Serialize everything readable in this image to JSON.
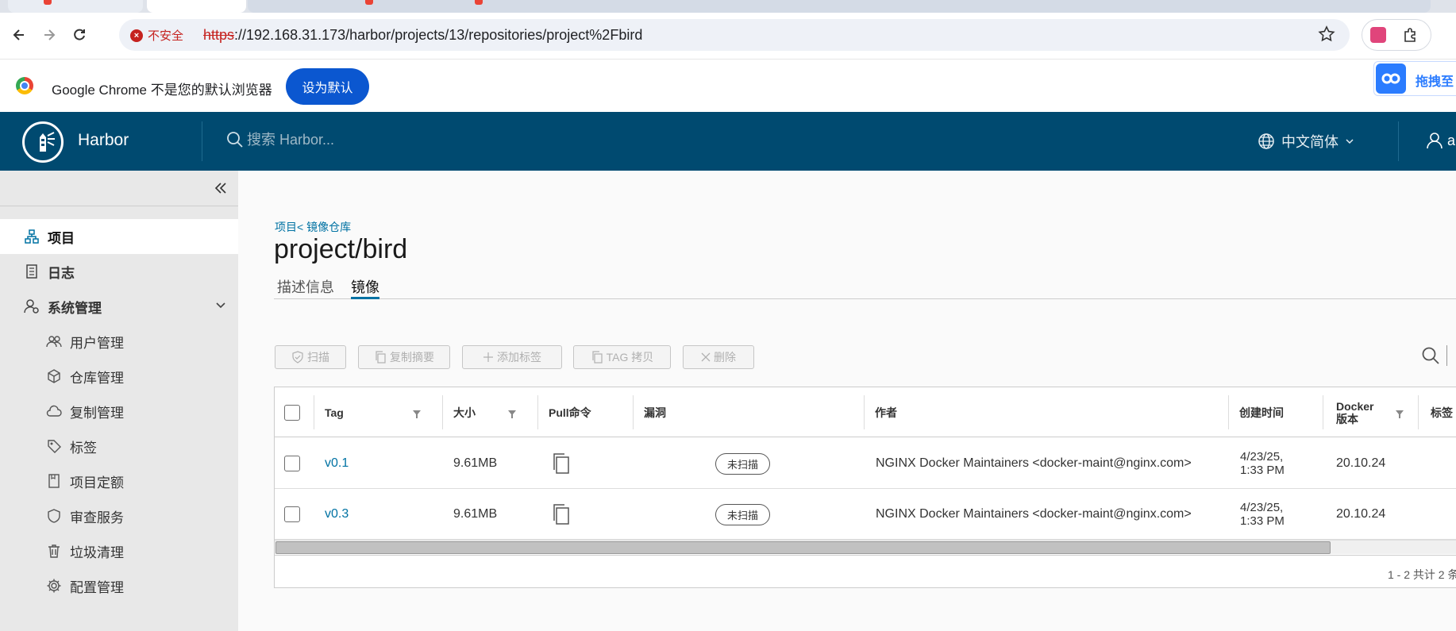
{
  "browser": {
    "security_label": "不安全",
    "url_scheme": "https",
    "url_rest": "://192.168.31.173/harbor/projects/13/repositories/project%2Fbird",
    "infobar_text": "Google Chrome 不是您的默认浏览器",
    "set_default_label": "设为默认",
    "baidu_label": "拖拽至"
  },
  "header": {
    "brand": "Harbor",
    "search_placeholder": "搜索 Harbor...",
    "language": "中文简体",
    "user_initial": "a"
  },
  "sidebar": {
    "top_items": [
      {
        "label": "项目",
        "icon": "project-icon"
      },
      {
        "label": "日志",
        "icon": "log-icon"
      },
      {
        "label": "系统管理",
        "icon": "admin-icon"
      }
    ],
    "sub_items": [
      {
        "label": "用户管理",
        "icon": "users-icon"
      },
      {
        "label": "仓库管理",
        "icon": "registry-icon"
      },
      {
        "label": "复制管理",
        "icon": "replication-icon"
      },
      {
        "label": "标签",
        "icon": "tag-icon"
      },
      {
        "label": "项目定额",
        "icon": "quota-icon"
      },
      {
        "label": "审查服务",
        "icon": "shield-icon"
      },
      {
        "label": "垃圾清理",
        "icon": "trash-icon"
      },
      {
        "label": "配置管理",
        "icon": "gear-icon"
      }
    ]
  },
  "page": {
    "breadcrumb": "项目< 镜像仓库",
    "title": "project/bird",
    "tabs": [
      "描述信息",
      "镜像"
    ],
    "active_tab": "镜像"
  },
  "actions": {
    "scan": "扫描",
    "copy_digest": "复制摘要",
    "add_label": "添加标签",
    "tag_copy": "TAG 拷贝",
    "delete": "删除"
  },
  "table": {
    "columns": {
      "tag": "Tag",
      "size": "大小",
      "pull": "Pull命令",
      "vuln": "漏洞",
      "author": "作者",
      "created": "创建时间",
      "docker_line1": "Docker",
      "docker_line2": "版本",
      "labels": "标签"
    },
    "rows": [
      {
        "tag": "v0.1",
        "size": "9.61MB",
        "vuln": "未扫描",
        "author": "NGINX Docker Maintainers <docker-maint@nginx.com>",
        "created_line1": "4/23/25,",
        "created_line2": "1:33 PM",
        "docker": "20.10.24"
      },
      {
        "tag": "v0.3",
        "size": "9.61MB",
        "vuln": "未扫描",
        "author": "NGINX Docker Maintainers <docker-maint@nginx.com>",
        "created_line1": "4/23/25,",
        "created_line2": "1:33 PM",
        "docker": "20.10.24"
      }
    ],
    "pagination": "1 - 2 共计 2 条"
  },
  "colors": {
    "header_bg": "#004a70",
    "accent": "#0072a3",
    "sidebar_bg": "#e8e8e8",
    "chrome_blue": "#0b57d0"
  }
}
